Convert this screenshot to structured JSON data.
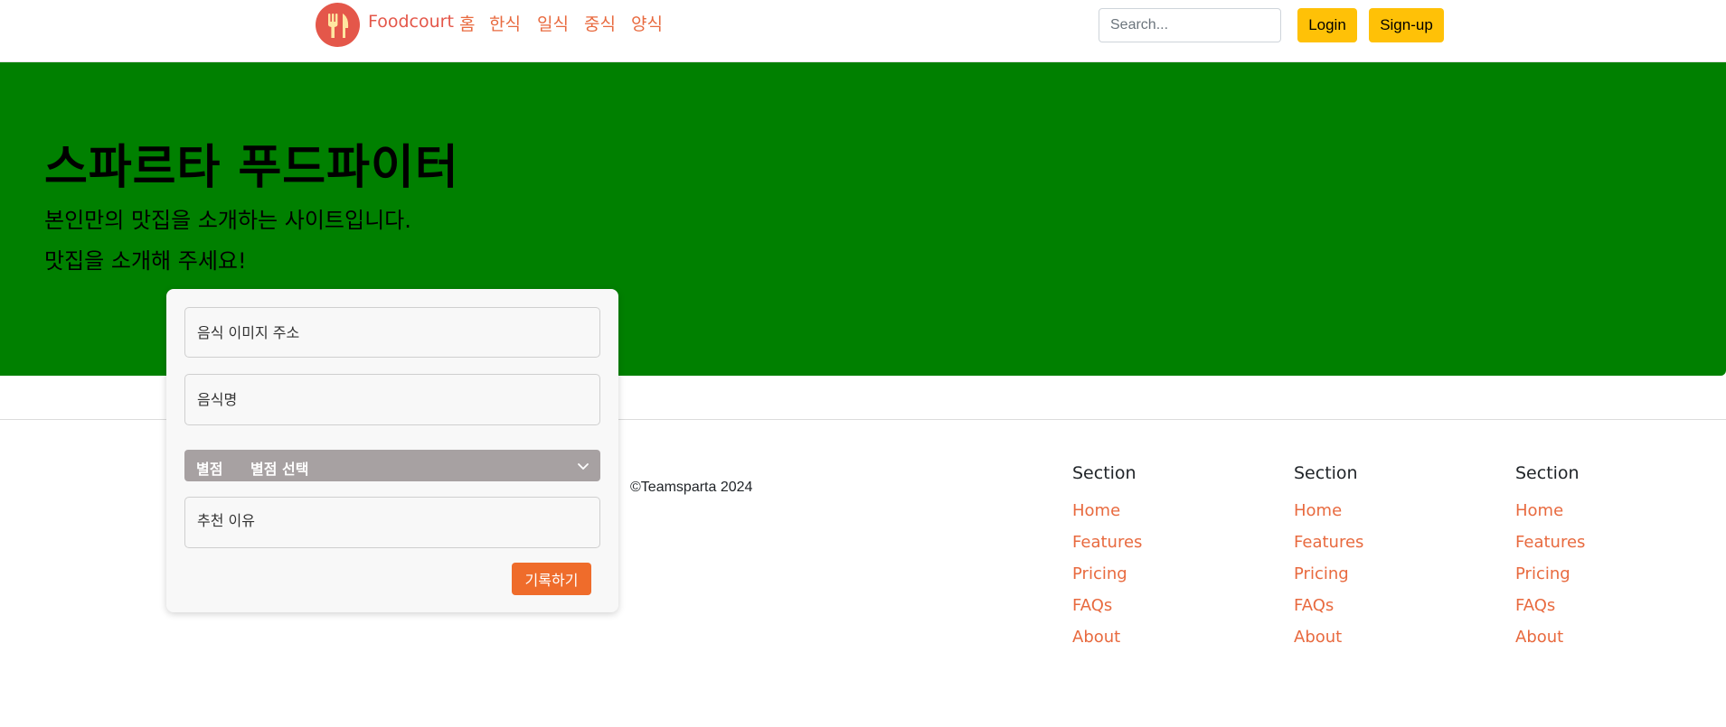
{
  "header": {
    "brand": "Foodcourt",
    "nav": [
      "홈",
      "한식",
      "일식",
      "중식",
      "양식"
    ],
    "search_placeholder": "Search...",
    "login_label": "Login",
    "signup_label": "Sign-up"
  },
  "hero": {
    "title": "스파르타 푸드파이터",
    "subtitle1": "본인만의 맛집을 소개하는 사이트입니다.",
    "subtitle2": "맛집을 소개해 주세요!"
  },
  "form": {
    "image_url_placeholder": "음식 이미지 주소",
    "food_name_placeholder": "음식명",
    "rating_prefix": "별점",
    "rating_selected": "별점 선택",
    "reason_placeholder": "추천 이유",
    "submit_label": "기록하기"
  },
  "footer": {
    "copyright": "©Teamsparta 2024",
    "columns": [
      {
        "title": "Section",
        "links": [
          "Home",
          "Features",
          "Pricing",
          "FAQs",
          "About"
        ]
      },
      {
        "title": "Section",
        "links": [
          "Home",
          "Features",
          "Pricing",
          "FAQs",
          "About"
        ]
      },
      {
        "title": "Section",
        "links": [
          "Home",
          "Features",
          "Pricing",
          "FAQs",
          "About"
        ]
      }
    ]
  },
  "colors": {
    "hero_bg": "#008000",
    "accent": "#e86a3f",
    "brand": "#e4574a",
    "button_yellow": "#ffc107",
    "submit": "#ef6c2b"
  },
  "icons": {
    "brand_logo": "fork-knife-icon",
    "select_chevron": "chevron-down-icon"
  }
}
